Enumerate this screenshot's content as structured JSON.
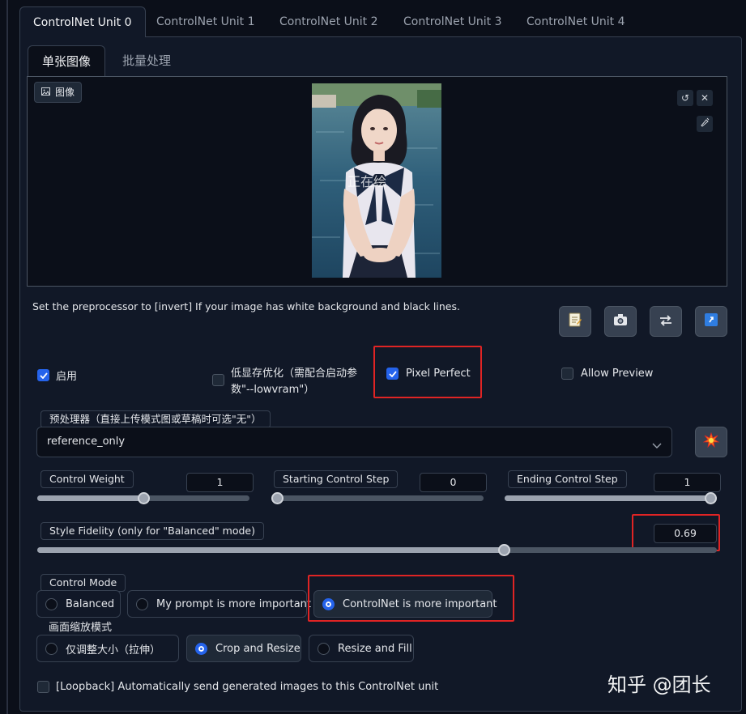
{
  "unit_tabs": [
    "ControlNet Unit 0",
    "ControlNet Unit 1",
    "ControlNet Unit 2",
    "ControlNet Unit 3",
    "ControlNet Unit 4"
  ],
  "image_tabs": [
    "单张图像",
    "批量处理"
  ],
  "image_panel": {
    "label": "图像",
    "label_icon": "image-icon",
    "overlay_text": "正在绘",
    "actions": [
      "undo-icon",
      "close-icon",
      "brush-icon"
    ]
  },
  "hint": "Set the preprocessor to [invert] If your image has white background and black lines.",
  "tool_buttons": [
    "notepad-icon",
    "camera-icon",
    "swap-icon",
    "send-dimensions-icon"
  ],
  "options": {
    "enable": {
      "label": "启用",
      "checked": true
    },
    "low_vram": {
      "label_line1": "低显存优化（需配合启动参",
      "label_line2": "数\"--lowvram\"）",
      "checked": false
    },
    "pixel_perfect": {
      "label": "Pixel Perfect",
      "checked": true
    },
    "allow_preview": {
      "label": "Allow Preview",
      "checked": false
    }
  },
  "preprocessor": {
    "label": "预处理器（直接上传模式图或草稿时可选\"无\"）",
    "value": "reference_only",
    "run_icon": "explosion-icon"
  },
  "sliders": {
    "control_weight": {
      "label": "Control Weight",
      "value": "1",
      "fraction": 0.5
    },
    "starting_step": {
      "label": "Starting Control Step",
      "value": "0",
      "fraction": 0.0
    },
    "ending_step": {
      "label": "Ending Control Step",
      "value": "1",
      "fraction": 1.0
    },
    "style_fidelity": {
      "label": "Style Fidelity (only for \"Balanced\" mode)",
      "value": "0.69",
      "fraction": 0.69
    }
  },
  "control_mode": {
    "label": "Control Mode",
    "options": [
      "Balanced",
      "My prompt is more important",
      "ControlNet is more important"
    ],
    "selected": 2
  },
  "resize_mode": {
    "label": "画面缩放模式",
    "options": [
      "仅调整大小（拉伸）",
      "Crop and Resize",
      "Resize and Fill"
    ],
    "selected": 1
  },
  "loopback": {
    "label": "[Loopback] Automatically send generated images to this ControlNet unit",
    "checked": false
  },
  "watermark": "知乎 @团长",
  "colors": {
    "accent": "#2563eb",
    "highlight": "#e02424",
    "background": "#0b0f19"
  }
}
